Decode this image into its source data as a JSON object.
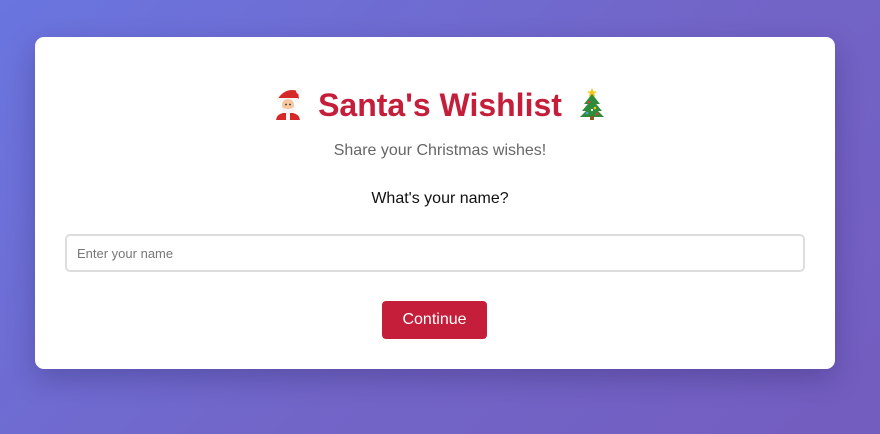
{
  "header": {
    "title": "Santa's Wishlist",
    "title_icon_left": "santa-icon",
    "title_icon_right": "christmas-tree-icon",
    "subtitle": "Share your Christmas wishes!"
  },
  "form": {
    "question": "What's your name?",
    "name_input": {
      "value": "",
      "placeholder": "Enter your name"
    },
    "continue_label": "Continue"
  },
  "colors": {
    "accent": "#c41e3a",
    "background_start": "#6a75df",
    "background_end": "#735dbf",
    "card": "#ffffff"
  }
}
